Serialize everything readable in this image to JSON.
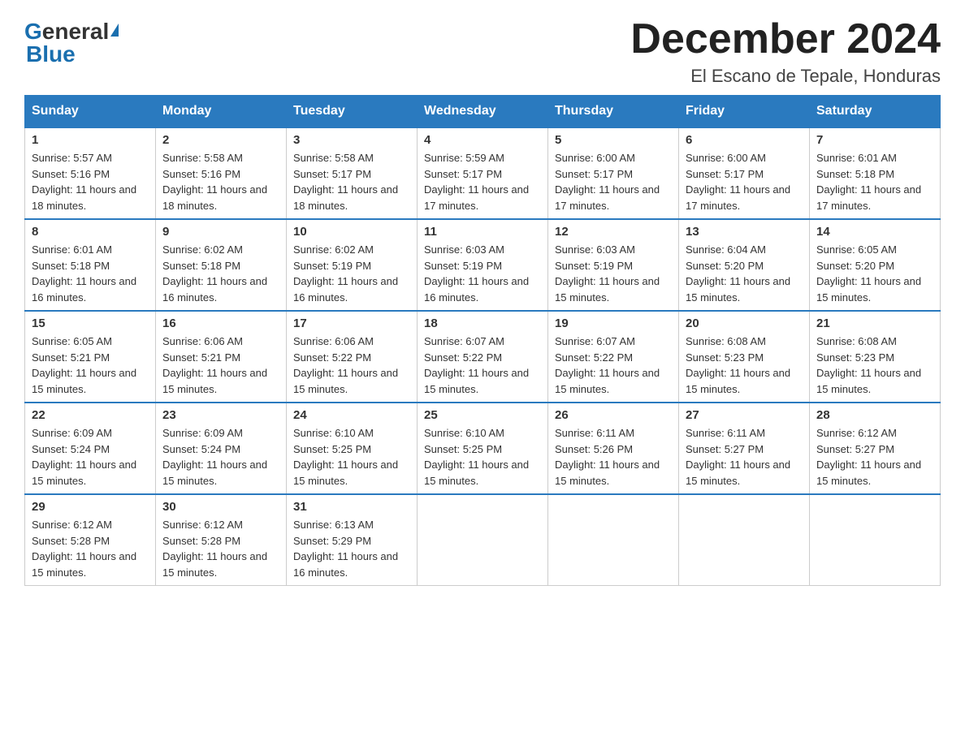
{
  "logo": {
    "general": "General",
    "blue": "Blue"
  },
  "header": {
    "title": "December 2024",
    "subtitle": "El Escano de Tepale, Honduras"
  },
  "weekdays": [
    "Sunday",
    "Monday",
    "Tuesday",
    "Wednesday",
    "Thursday",
    "Friday",
    "Saturday"
  ],
  "weeks": [
    [
      {
        "day": "1",
        "sunrise": "5:57 AM",
        "sunset": "5:16 PM",
        "daylight": "11 hours and 18 minutes."
      },
      {
        "day": "2",
        "sunrise": "5:58 AM",
        "sunset": "5:16 PM",
        "daylight": "11 hours and 18 minutes."
      },
      {
        "day": "3",
        "sunrise": "5:58 AM",
        "sunset": "5:17 PM",
        "daylight": "11 hours and 18 minutes."
      },
      {
        "day": "4",
        "sunrise": "5:59 AM",
        "sunset": "5:17 PM",
        "daylight": "11 hours and 17 minutes."
      },
      {
        "day": "5",
        "sunrise": "6:00 AM",
        "sunset": "5:17 PM",
        "daylight": "11 hours and 17 minutes."
      },
      {
        "day": "6",
        "sunrise": "6:00 AM",
        "sunset": "5:17 PM",
        "daylight": "11 hours and 17 minutes."
      },
      {
        "day": "7",
        "sunrise": "6:01 AM",
        "sunset": "5:18 PM",
        "daylight": "11 hours and 17 minutes."
      }
    ],
    [
      {
        "day": "8",
        "sunrise": "6:01 AM",
        "sunset": "5:18 PM",
        "daylight": "11 hours and 16 minutes."
      },
      {
        "day": "9",
        "sunrise": "6:02 AM",
        "sunset": "5:18 PM",
        "daylight": "11 hours and 16 minutes."
      },
      {
        "day": "10",
        "sunrise": "6:02 AM",
        "sunset": "5:19 PM",
        "daylight": "11 hours and 16 minutes."
      },
      {
        "day": "11",
        "sunrise": "6:03 AM",
        "sunset": "5:19 PM",
        "daylight": "11 hours and 16 minutes."
      },
      {
        "day": "12",
        "sunrise": "6:03 AM",
        "sunset": "5:19 PM",
        "daylight": "11 hours and 15 minutes."
      },
      {
        "day": "13",
        "sunrise": "6:04 AM",
        "sunset": "5:20 PM",
        "daylight": "11 hours and 15 minutes."
      },
      {
        "day": "14",
        "sunrise": "6:05 AM",
        "sunset": "5:20 PM",
        "daylight": "11 hours and 15 minutes."
      }
    ],
    [
      {
        "day": "15",
        "sunrise": "6:05 AM",
        "sunset": "5:21 PM",
        "daylight": "11 hours and 15 minutes."
      },
      {
        "day": "16",
        "sunrise": "6:06 AM",
        "sunset": "5:21 PM",
        "daylight": "11 hours and 15 minutes."
      },
      {
        "day": "17",
        "sunrise": "6:06 AM",
        "sunset": "5:22 PM",
        "daylight": "11 hours and 15 minutes."
      },
      {
        "day": "18",
        "sunrise": "6:07 AM",
        "sunset": "5:22 PM",
        "daylight": "11 hours and 15 minutes."
      },
      {
        "day": "19",
        "sunrise": "6:07 AM",
        "sunset": "5:22 PM",
        "daylight": "11 hours and 15 minutes."
      },
      {
        "day": "20",
        "sunrise": "6:08 AM",
        "sunset": "5:23 PM",
        "daylight": "11 hours and 15 minutes."
      },
      {
        "day": "21",
        "sunrise": "6:08 AM",
        "sunset": "5:23 PM",
        "daylight": "11 hours and 15 minutes."
      }
    ],
    [
      {
        "day": "22",
        "sunrise": "6:09 AM",
        "sunset": "5:24 PM",
        "daylight": "11 hours and 15 minutes."
      },
      {
        "day": "23",
        "sunrise": "6:09 AM",
        "sunset": "5:24 PM",
        "daylight": "11 hours and 15 minutes."
      },
      {
        "day": "24",
        "sunrise": "6:10 AM",
        "sunset": "5:25 PM",
        "daylight": "11 hours and 15 minutes."
      },
      {
        "day": "25",
        "sunrise": "6:10 AM",
        "sunset": "5:25 PM",
        "daylight": "11 hours and 15 minutes."
      },
      {
        "day": "26",
        "sunrise": "6:11 AM",
        "sunset": "5:26 PM",
        "daylight": "11 hours and 15 minutes."
      },
      {
        "day": "27",
        "sunrise": "6:11 AM",
        "sunset": "5:27 PM",
        "daylight": "11 hours and 15 minutes."
      },
      {
        "day": "28",
        "sunrise": "6:12 AM",
        "sunset": "5:27 PM",
        "daylight": "11 hours and 15 minutes."
      }
    ],
    [
      {
        "day": "29",
        "sunrise": "6:12 AM",
        "sunset": "5:28 PM",
        "daylight": "11 hours and 15 minutes."
      },
      {
        "day": "30",
        "sunrise": "6:12 AM",
        "sunset": "5:28 PM",
        "daylight": "11 hours and 15 minutes."
      },
      {
        "day": "31",
        "sunrise": "6:13 AM",
        "sunset": "5:29 PM",
        "daylight": "11 hours and 16 minutes."
      },
      null,
      null,
      null,
      null
    ]
  ]
}
